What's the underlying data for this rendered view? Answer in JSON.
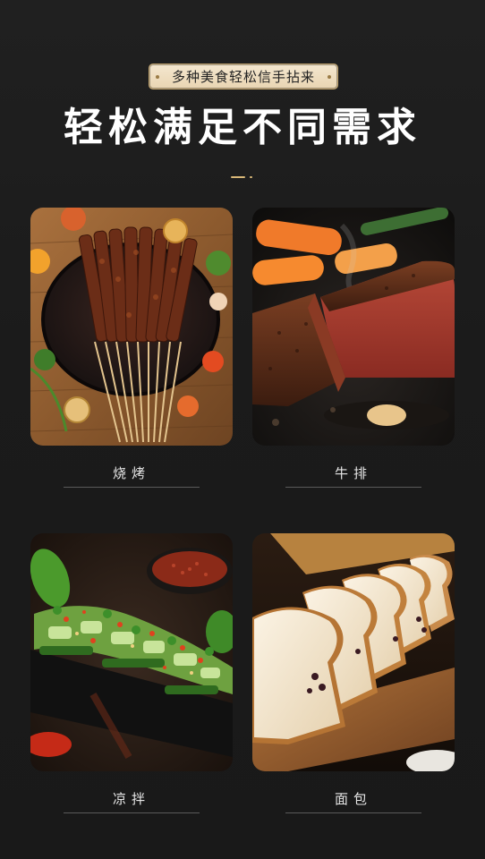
{
  "header": {
    "tag": "多种美食轻松信手拈来",
    "title": "轻松满足不同需求"
  },
  "foods": [
    {
      "label": "烧烤",
      "image": "bbq-skewers-image"
    },
    {
      "label": "牛排",
      "image": "steak-image"
    },
    {
      "label": "凉拌",
      "image": "cold-cucumber-salad-image"
    },
    {
      "label": "面包",
      "image": "sliced-bread-image"
    }
  ],
  "colors": {
    "background": "#1d1d1d",
    "accent_gold": "#d9b878",
    "pill_background": "#efdfc2",
    "text_light": "#e6e6e6"
  }
}
